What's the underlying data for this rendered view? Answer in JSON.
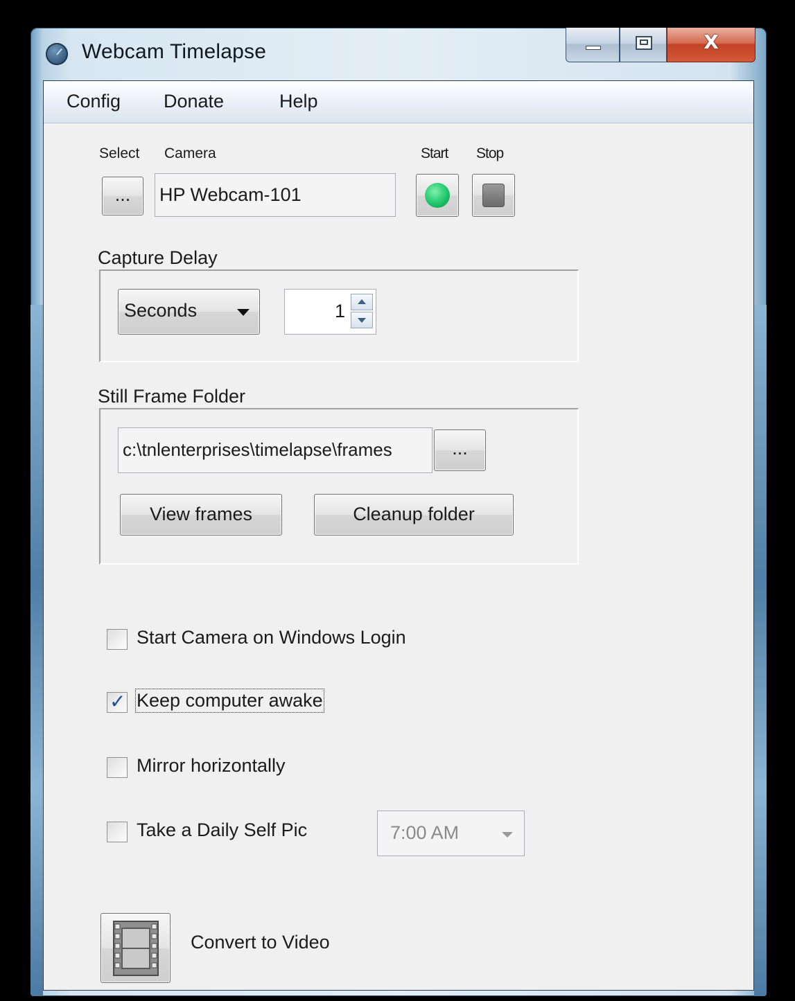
{
  "window": {
    "title": "Webcam Timelapse"
  },
  "menu": {
    "items": [
      "Config",
      "Donate",
      "Help"
    ]
  },
  "camera": {
    "select_label": "Select",
    "camera_label": "Camera",
    "select_button": "...",
    "camera_name": "HP Webcam-101",
    "start_label": "Start",
    "stop_label": "Stop"
  },
  "capture_delay": {
    "label": "Capture Delay",
    "unit": "Seconds",
    "value": "1"
  },
  "folder": {
    "label": "Still Frame Folder",
    "path": "c:\\tnlenterprises\\timelapse\\frames",
    "browse_button": "...",
    "view_button": "View frames",
    "cleanup_button": "Cleanup folder"
  },
  "options": {
    "start_on_login": {
      "label": "Start Camera on Windows Login",
      "checked": false
    },
    "keep_awake": {
      "label": "Keep computer awake",
      "checked": true
    },
    "mirror": {
      "label": "Mirror horizontally",
      "checked": false
    },
    "daily_pic": {
      "label": "Take a Daily Self Pic",
      "checked": false,
      "time": "7:00 AM"
    }
  },
  "convert": {
    "label": "Convert to Video"
  },
  "colors": {
    "start_indicator": "#1ec76a",
    "close_button": "#c9452a",
    "window_frame": "#b9d3e6"
  },
  "icons": [
    "app-clock-icon",
    "minimize-icon",
    "maximize-icon",
    "close-icon",
    "start-icon",
    "stop-icon",
    "chevron-down-icon",
    "spin-up-icon",
    "spin-down-icon",
    "film-strip-icon"
  ]
}
